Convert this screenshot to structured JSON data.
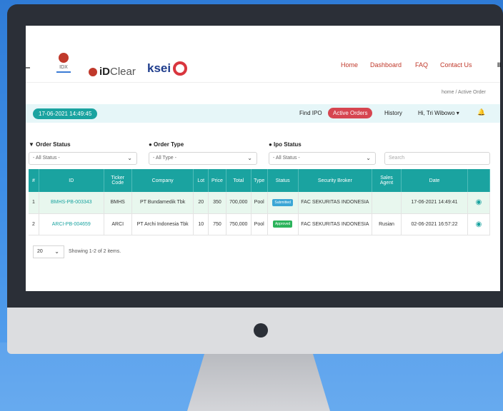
{
  "header": {
    "logo_idx": "IDX",
    "logo_idclear_bold": "iD",
    "logo_idclear_light": "Clear",
    "logo_ksei": "ksei",
    "nav": [
      "Home",
      "Dashboard",
      "FAQ",
      "Contact Us",
      "ID"
    ],
    "breadcrumb": "home / Active Order"
  },
  "toolbar": {
    "datetime": "17-06-2021 14:49:45",
    "find_ipo": "Find IPO",
    "active_orders": "Active Orders",
    "history": "History",
    "user": "Hi, Tri Wibowo ▾",
    "bell": "🔔"
  },
  "filters": {
    "order_status_label": "▼ Order Status",
    "order_type_label": "● Order Type",
    "ipo_status_label": "● Ipo Status",
    "order_status_value": "- All Status -",
    "order_type_value": "- All Type -",
    "ipo_status_value": "- All Status -",
    "search_placeholder": "Search"
  },
  "table": {
    "headers": [
      "#",
      "ID",
      "Ticker Code",
      "Company",
      "Lot",
      "Price",
      "Total",
      "Type",
      "Status",
      "Security Broker",
      "Sales Agent",
      "Date",
      ""
    ],
    "rows": [
      {
        "n": "1",
        "id": "BMHS-PB-003343",
        "ticker": "BMHS",
        "company": "PT Bundamedik Tbk",
        "lot": "20",
        "price": "350",
        "total": "700,000",
        "type": "Pool",
        "status": "Submitted",
        "broker": "FAC SEKURITAS INDONESIA",
        "agent": "",
        "date": "17-06-2021 14:49:41"
      },
      {
        "n": "2",
        "id": "ARCI-PB-004659",
        "ticker": "ARCI",
        "company": "PT Archi Indonesia Tbk",
        "lot": "10",
        "price": "750",
        "total": "750,000",
        "type": "Pool",
        "status": "Approved",
        "broker": "FAC SEKURITAS INDONESIA",
        "agent": "Rusian",
        "date": "02-06-2021 16:57:22"
      }
    ]
  },
  "footer": {
    "page_size": "20",
    "showing": "Showing 1-2 of 2 items."
  },
  "colors": {
    "accent_teal": "#1aa3a0",
    "active_red": "#d64550",
    "background_blue": "#3e8ee6"
  }
}
